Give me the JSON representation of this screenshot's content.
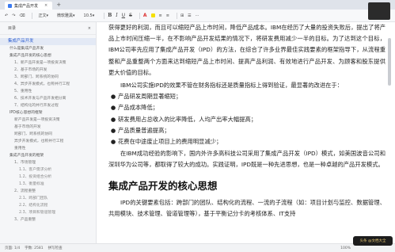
{
  "window": {
    "tab_title": "集成产品开发",
    "tab_close": "×",
    "new_tab": "+",
    "controls": [
      "—",
      "▢",
      "✕"
    ]
  },
  "toolbar": {
    "items": [
      "↶",
      "↷",
      "⌫",
      "|",
      "正文",
      "▾",
      "微软雅黑",
      "▾",
      "10.5",
      "▾",
      "|",
      "B",
      "I",
      "U",
      "S",
      "|",
      "A",
      "▾",
      "≡",
      "≡",
      "|",
      "⊞",
      "▾",
      "☰",
      "⋯"
    ]
  },
  "sidebar": {
    "header": "目录",
    "header_close": "×",
    "items": [
      {
        "level": 1,
        "label": "集成产品开发"
      },
      {
        "level": 2,
        "label": "什么是集成产品开发"
      },
      {
        "level": 2,
        "label": "集成产品开发的核心思想"
      },
      {
        "level": 3,
        "label": "1、新产品开发是一项投资决策"
      },
      {
        "level": 3,
        "label": "2、基于市场的开发"
      },
      {
        "level": 3,
        "label": "3、跨部门、跨系统的协同"
      },
      {
        "level": 3,
        "label": "4、异步开发模式，也称并行工程"
      },
      {
        "level": 3,
        "label": "5、重用性"
      },
      {
        "level": 3,
        "label": "6、技术开发与产品开发相分离"
      },
      {
        "level": 3,
        "label": "7、结构化的并行开发过程"
      },
      {
        "level": 2,
        "label": "IPD核心思想的框架"
      },
      {
        "level": 3,
        "label": "新产品开发是一项投资决策"
      },
      {
        "level": 3,
        "label": "基于市场的开发"
      },
      {
        "level": 3,
        "label": "跨部门、跨系统的协同"
      },
      {
        "level": 3,
        "label": "异步开发模式，也称并行工程"
      },
      {
        "level": 3,
        "label": "重用性"
      },
      {
        "level": 2,
        "label": "集成产品开发的框架"
      },
      {
        "level": 3,
        "label": "1、市场管理"
      },
      {
        "level": 4,
        "label": "1.1、客户需求分析"
      },
      {
        "level": 4,
        "label": "1.2、投资组合分析"
      },
      {
        "level": 4,
        "label": "1.3、衡量标准"
      },
      {
        "level": 3,
        "label": "2、流程重整"
      },
      {
        "level": 4,
        "label": "2.1、跨部门团队"
      },
      {
        "level": 4,
        "label": "2.2、结构化流程"
      },
      {
        "level": 4,
        "label": "2.3、项目和管道管理"
      },
      {
        "level": 3,
        "label": "3、产品重整"
      }
    ]
  },
  "content": {
    "para1": "获得更好的利润，而且可以缩短产品上市时间，降低产品成本。IBM在经历了大量的投资失败后，提出了将产品上市时间压缩一半，在不影响产品开发结果的情况下，将研发费用减少一半的目标。为了达到这个目标，IBM公司率先应用了集成产品开发（IPD）的方法，在综合了许多业界最佳实践要素的框架指导下，从流程重整和产品重整两个方面来达到缩短产品上市时间、提高产品利润、有效地进行产品开发、为顾客和股东提供更大价值的目标。",
    "para2": "IBM公司实施IPD的效果不管在财务指标还是质量指标上得到验证，最显著的改进在于：",
    "bullets": [
      "产品研发周期显著缩短；",
      "产品成本降低；",
      "研发费用占总收入的比率降低，人均产出率大幅提高；",
      "产品质量普遍提高；",
      "花费在中途废止项目上的费用明显减少；"
    ],
    "para3": "在IBM成功经验的影响下，国内外许多高科技公司采用了集成产品开发（IPD）模式，如美国波音公司和深圳华为公司等，都取得了较大的成功。实践证明，IPD既是一种先进思想，也是一种卓越的产品开发模式。",
    "heading": "集成产品开发的核心思想",
    "para4": "IPD的关键要素包括：跨部门的团队、结构化的流程、一流的子流程（如：项目计划与监控、数据管理、共用模块、技术管理、管道管理等），基于平衡记分卡的考核体系、IT支持"
  },
  "statusbar": {
    "page": "页面: 1/4",
    "words": "字数: 2581",
    "spell": "拼写检查",
    "zoom": "100%",
    "watermark": "头条 @文档大全"
  }
}
